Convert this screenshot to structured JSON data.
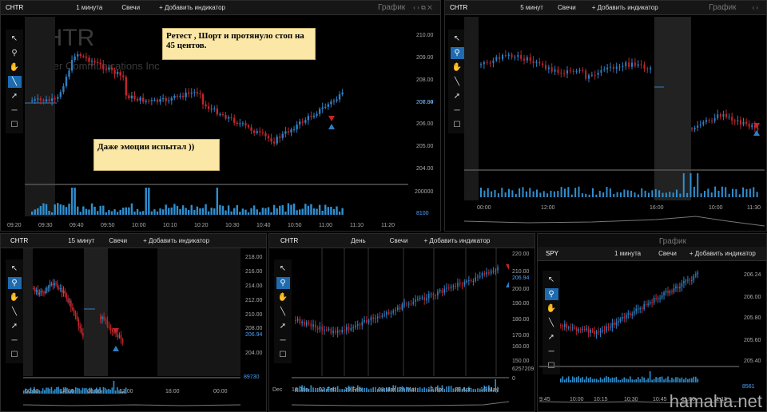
{
  "panels": {
    "p1": {
      "symbol": "CHTR",
      "interval": "1 минута",
      "type": "Свечи",
      "add": "+ Добавить индикатор",
      "window": "График",
      "watermark": "CHTR",
      "company": "Charter Communications Inc",
      "yticks": [
        "210.00",
        "209.00",
        "208.00",
        "207.00",
        "206.00",
        "205.00",
        "204.00"
      ],
      "price": "206.94",
      "vol_label": "200000",
      "vol_label2": "8100",
      "xticks": [
        "09:20",
        "09:30",
        "09:40",
        "09:50",
        "10:00",
        "10:10",
        "10:20",
        "10:30",
        "10:40",
        "10:50",
        "11:00",
        "11:10",
        "11:20"
      ],
      "note1": "Ретест , Шорт   и протянуло стоп на 45 центов.",
      "note2": "Даже эмоции испытал ))"
    },
    "p2": {
      "symbol": "CHTR",
      "interval": "5 минут",
      "type": "Свечи",
      "add": "+ Добавить индикатор",
      "window": "График",
      "xticks": [
        "00:00",
        "12:00",
        "16:00",
        "10:00",
        "11:30"
      ]
    },
    "p3": {
      "symbol": "CHTR",
      "interval": "15 минут",
      "type": "Свечи",
      "add": "+ Добавить индикатор",
      "yticks": [
        "218.00",
        "216.00",
        "214.00",
        "212.00",
        "210.00",
        "208.00",
        "206.94",
        "204.00"
      ],
      "vol_label": "89730",
      "xticks": [
        "00:00",
        "14:00",
        "08:00",
        "12:00",
        "18:00",
        "00:00"
      ]
    },
    "p4": {
      "symbol": "CHTR",
      "interval": "День",
      "type": "Свечи",
      "add": "+ Добавить индикатор",
      "yticks": [
        "220.00",
        "210.00",
        "206.94",
        "200.00",
        "190.00",
        "180.00",
        "170.00",
        "160.00",
        "150.00"
      ],
      "vol_label": "6257209",
      "vol_label2": "0",
      "xticks": [
        "Dec",
        "14 Jan",
        "02 Feb",
        "19 Feb",
        "08 Mar",
        "24 Mar",
        "12 Apr",
        "28 Apr",
        "16 May"
      ]
    },
    "p5": {
      "symbol": "SPY",
      "interval": "1 минута",
      "type": "Свечи",
      "add": "+ Добавить индикатор",
      "window": "График",
      "yticks": [
        "206.24",
        "206.00",
        "205.80",
        "205.60",
        "205.40"
      ],
      "vol_label": "8561",
      "xticks": [
        "9:45",
        "10:00",
        "10:15",
        "10:30",
        "10:45",
        "11:00",
        "11:15"
      ]
    }
  },
  "tools": [
    "cursor-icon",
    "zoom-icon",
    "hand-icon",
    "line-icon",
    "arrow-icon",
    "hline-icon",
    "rect-icon"
  ],
  "tool_glyphs": [
    "↖",
    "⚲",
    "✋",
    "╲",
    "➚",
    "─",
    "☐"
  ],
  "site_watermark": "hamaha.net",
  "colors": {
    "up": "#2f7fc4",
    "down": "#c0262c",
    "volume": "#2f8fd0",
    "accent": "#1e6bb0"
  }
}
